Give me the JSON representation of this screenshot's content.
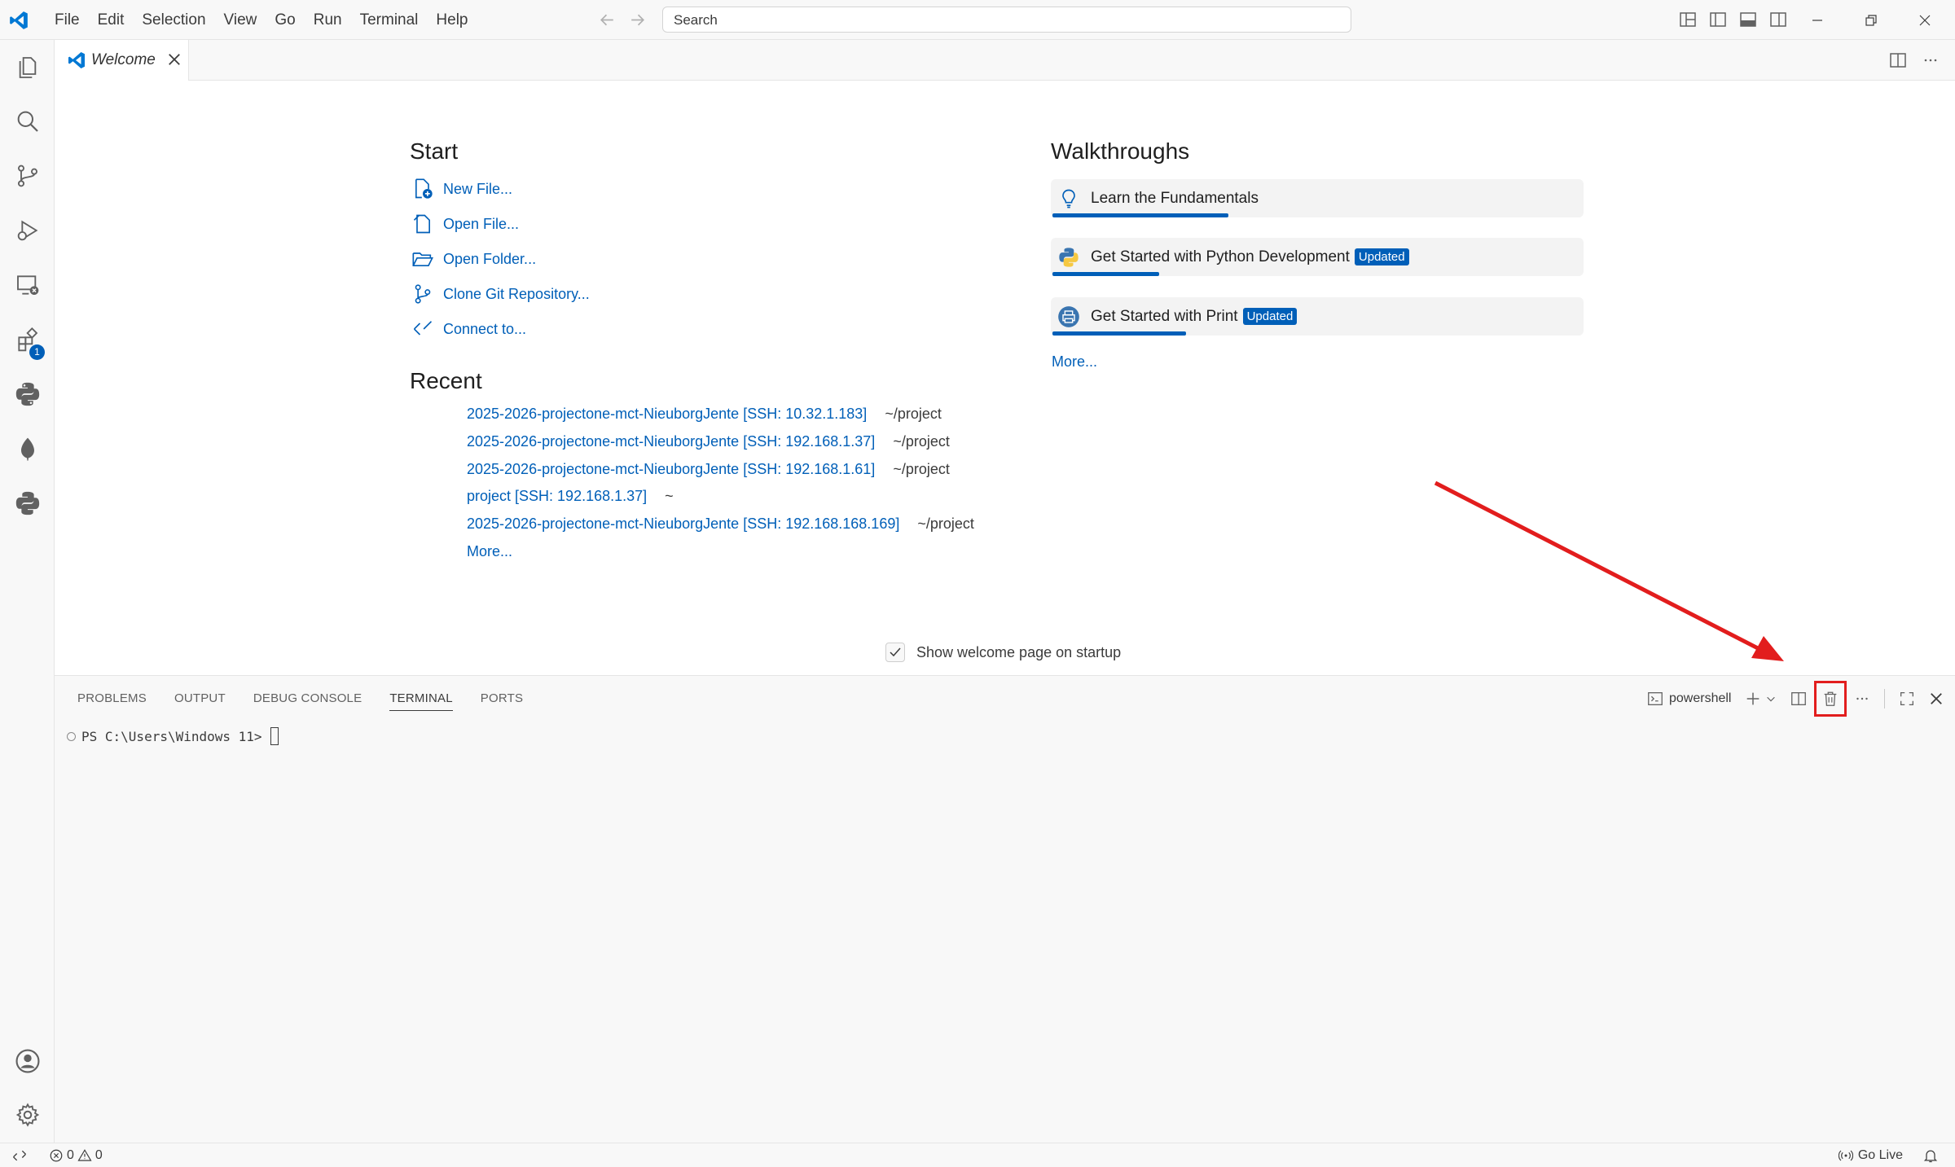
{
  "titlebar": {
    "menu": [
      "File",
      "Edit",
      "Selection",
      "View",
      "Go",
      "Run",
      "Terminal",
      "Help"
    ],
    "search_placeholder": "Search"
  },
  "activity_bar": {
    "items": [
      "explorer-icon",
      "search-icon",
      "source-control-icon",
      "run-debug-icon",
      "remote-explorer-icon",
      "extensions-icon",
      "python-icon",
      "mongodb-leaf-icon",
      "python-icon"
    ],
    "extensions_badge": "1",
    "bottom": [
      "account-icon",
      "settings-gear-icon"
    ]
  },
  "tab": {
    "label": "Welcome"
  },
  "welcome": {
    "start_title": "Start",
    "start_items": [
      "New File...",
      "Open File...",
      "Open Folder...",
      "Clone Git Repository...",
      "Connect to..."
    ],
    "recent_title": "Recent",
    "recent": [
      {
        "name": "2025-2026-projectone-mct-NieuborgJente [SSH: 10.32.1.183]",
        "path": "~/project"
      },
      {
        "name": "2025-2026-projectone-mct-NieuborgJente [SSH: 192.168.1.37]",
        "path": "~/project"
      },
      {
        "name": "2025-2026-projectone-mct-NieuborgJente [SSH: 192.168.1.61]",
        "path": "~/project"
      },
      {
        "name": "project [SSH: 192.168.1.37]",
        "path": "~"
      },
      {
        "name": "2025-2026-projectone-mct-NieuborgJente [SSH: 192.168.168.169]",
        "path": "~/project"
      }
    ],
    "recent_more": "More...",
    "walkthroughs_title": "Walkthroughs",
    "walkthroughs": [
      {
        "title": "Learn the Fundamentals",
        "badge": "",
        "progress": 0.33
      },
      {
        "title": "Get Started with Python Development",
        "badge": "Updated",
        "progress": 0.2
      },
      {
        "title": "Get Started with Print",
        "badge": "Updated",
        "progress": 0.25
      }
    ],
    "walkthroughs_more": "More...",
    "show_on_startup_label": "Show welcome page on startup",
    "show_on_startup_checked": true
  },
  "panel": {
    "tabs": [
      "PROBLEMS",
      "OUTPUT",
      "DEBUG CONSOLE",
      "TERMINAL",
      "PORTS"
    ],
    "active_tab": "TERMINAL",
    "shell_name": "powershell",
    "prompt": "PS C:\\Users\\Windows 11>"
  },
  "statusbar": {
    "errors": "0",
    "warnings": "0",
    "go_live": "Go Live"
  },
  "colors": {
    "accent": "#005fb8",
    "highlight": "#e21d1d"
  }
}
